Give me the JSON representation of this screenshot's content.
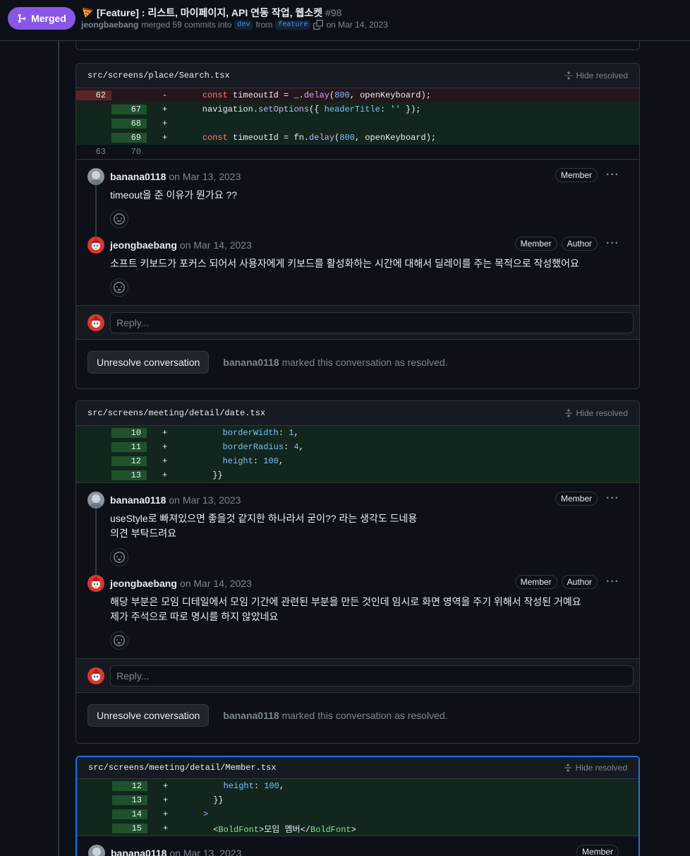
{
  "header": {
    "status_label": "Merged",
    "title": "[Feature] : 리스트, 마이페이지, API 연동 작업, 웹소켓",
    "number": "#98",
    "author": "jeongbaebang",
    "merged_text": "merged 59 commits into",
    "base_branch": "dev",
    "from_text": "from",
    "head_branch": "feature",
    "date_text": "on Mar 14, 2023"
  },
  "common": {
    "hide_resolved": "Hide resolved",
    "reply_placeholder": "Reply...",
    "unresolve_label": "Unresolve conversation",
    "resolved_by": "banana0118",
    "resolved_text": "marked this conversation as resolved.",
    "member_badge": "Member",
    "author_badge": "Author",
    "kebab": "···"
  },
  "threads": [
    {
      "file": "src/screens/place/Search.tsx",
      "comments": [
        {
          "author": "banana0118",
          "date": "on Mar 13, 2023",
          "body": [
            "timeout을 준 이유가 뭔가요 ??"
          ]
        },
        {
          "author": "jeongbaebang",
          "date": "on Mar 14, 2023",
          "body": [
            "소프트 키보드가 포커스 되어서 사용자에게 키보드를 활성화하는 시간에 대해서 딜레이를 주는 목적으로 작성했어요"
          ]
        }
      ]
    },
    {
      "file": "src/screens/meeting/detail/date.tsx",
      "comments": [
        {
          "author": "banana0118",
          "date": "on Mar 13, 2023",
          "body": [
            "useStyle로 빠져있으면 좋을것 같지한 하나라서 굳이?? 라는 생각도 드네용",
            "의견 부탁드려요"
          ]
        },
        {
          "author": "jeongbaebang",
          "date": "on Mar 14, 2023",
          "body": [
            "해당 부분은 모임 디테일에서 모임 기간에 관련된 부분을 만든 것인데 임시로 화면 영역을 주기 위해서 작성된 거예요",
            "제가 주석으로 따로 명시를 하지 않았네요"
          ]
        }
      ]
    },
    {
      "file": "src/screens/meeting/detail/Member.tsx",
      "comments": [
        {
          "author": "banana0118",
          "date": "on Mar 13, 2023",
          "body": []
        }
      ]
    }
  ],
  "diff1": {
    "del": {
      "old": "62",
      "sign": "-",
      "code": [
        "    ",
        "const",
        " timeoutId = _.",
        "delay",
        "(",
        "800",
        ", openKeyboard);"
      ]
    },
    "add": [
      {
        "new": "67",
        "sign": "+",
        "code": [
          "    navigation.",
          "setOptions",
          "({ ",
          "headerTitle",
          ": ",
          "''",
          " });"
        ]
      },
      {
        "new": "68",
        "sign": "+",
        "code": [
          ""
        ]
      },
      {
        "new": "69",
        "sign": "+",
        "code": [
          "    ",
          "const",
          " timeoutId = fn.",
          "delay",
          "(",
          "800",
          ", openKeyboard);"
        ]
      }
    ],
    "ctx": {
      "old": "63",
      "new": "70"
    }
  },
  "diff2": [
    {
      "new": "10",
      "sign": "+",
      "code": [
        "        ",
        "borderWidth",
        ": ",
        "1",
        ","
      ]
    },
    {
      "new": "11",
      "sign": "+",
      "code": [
        "        ",
        "borderRadius",
        ": ",
        "4",
        ","
      ]
    },
    {
      "new": "12",
      "sign": "+",
      "code": [
        "        ",
        "height",
        ": ",
        "100",
        ","
      ]
    },
    {
      "new": "13",
      "sign": "+",
      "code": [
        "      }}"
      ]
    }
  ],
  "diff3": [
    {
      "new": "12",
      "sign": "+",
      "code": [
        "        ",
        "height",
        ": ",
        "100",
        ","
      ]
    },
    {
      "new": "13",
      "sign": "+",
      "code": [
        "      }}"
      ]
    },
    {
      "new": "14",
      "sign": "+",
      "code": [
        "    ",
        ">"
      ]
    },
    {
      "new": "15",
      "sign": "+",
      "code": [
        "      <",
        "BoldFont",
        ">모임 멤버</",
        "BoldFont",
        ">"
      ]
    }
  ]
}
